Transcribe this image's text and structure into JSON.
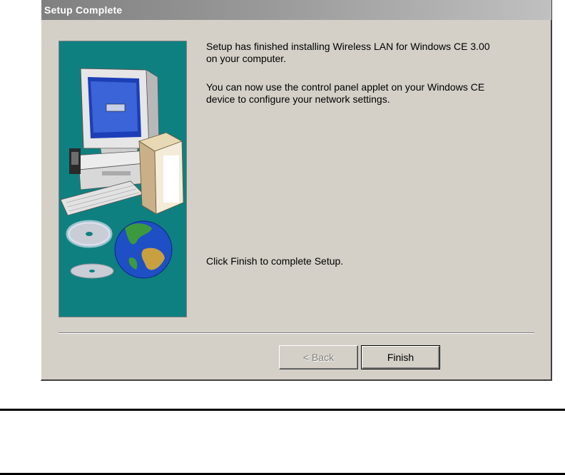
{
  "window": {
    "title": "Setup Complete"
  },
  "content": {
    "line1": "Setup has finished installing Wireless LAN for Windows CE 3.00",
    "line1b": "on your computer.",
    "line2": "You can now use the control panel applet on your Windows CE",
    "line2b": "device to configure your network settings.",
    "line3": "Click Finish to complete Setup."
  },
  "buttons": {
    "back_label": "< Back",
    "back_enabled": false,
    "finish_label": "Finish"
  },
  "colors": {
    "dialog_bg": "#d4d0c8",
    "banner_bg": "#0f8080",
    "titlebar_text": "#ffffff"
  },
  "icons": {
    "banner": [
      "computer-monitor-icon",
      "package-box-icon",
      "cd-disc-icon",
      "globe-icon"
    ]
  }
}
